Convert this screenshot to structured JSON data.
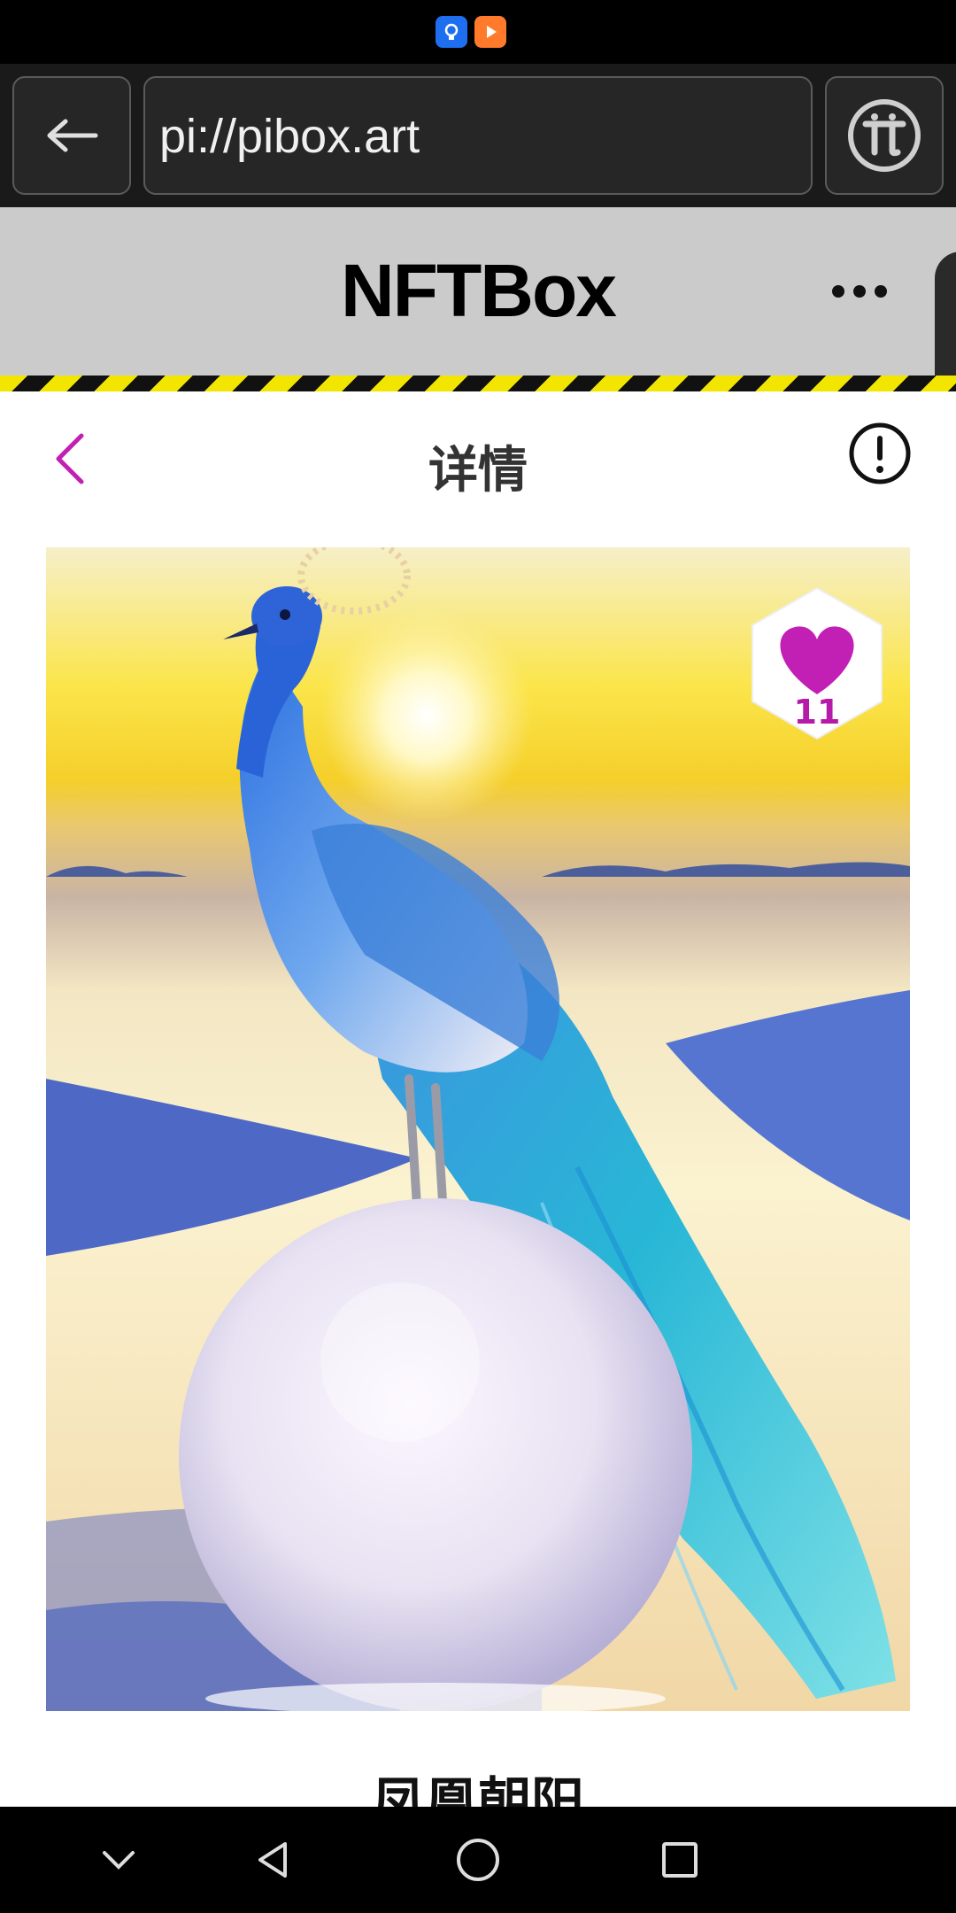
{
  "browser": {
    "url": "pi://pibox.art"
  },
  "site": {
    "title": "NFTBox"
  },
  "detail": {
    "title": "详情"
  },
  "artwork": {
    "likes": "11",
    "title": "凤凰朝阳"
  },
  "icons": {
    "status": [
      "bulb-icon",
      "play-icon"
    ],
    "browser": [
      "back-arrow-icon",
      "pi-logo-icon"
    ],
    "header": [
      "more-icon"
    ],
    "detail": [
      "chevron-left-icon",
      "report-icon"
    ],
    "badge": "heart-icon",
    "nav": [
      "chevron-down-icon",
      "nav-back-icon",
      "nav-home-icon",
      "nav-recents-icon"
    ]
  },
  "colors": {
    "accent": "#c21fb5",
    "stripe_yellow": "#f2e500",
    "header_bg": "#cbcbcb"
  }
}
